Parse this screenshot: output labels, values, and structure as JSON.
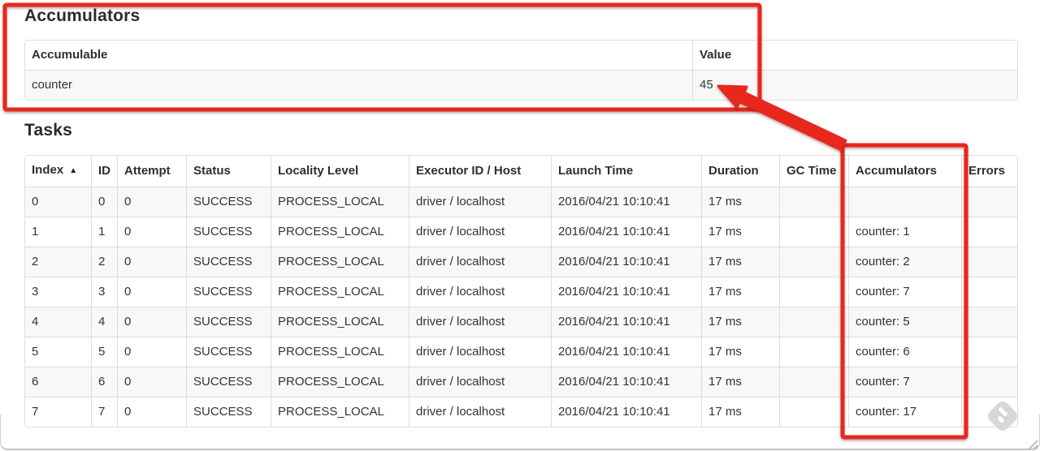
{
  "accumulators_section": {
    "title": "Accumulators",
    "table": {
      "headers": [
        "Accumulable",
        "Value"
      ],
      "rows": [
        [
          "counter",
          "45"
        ]
      ]
    }
  },
  "tasks_section": {
    "title": "Tasks",
    "table": {
      "headers": [
        "Index",
        "ID",
        "Attempt",
        "Status",
        "Locality Level",
        "Executor ID / Host",
        "Launch Time",
        "Duration",
        "GC Time",
        "Accumulators",
        "Errors"
      ],
      "sort_column": 0,
      "sort_icon": "▲",
      "rows": [
        [
          "0",
          "0",
          "0",
          "SUCCESS",
          "PROCESS_LOCAL",
          "driver / localhost",
          "2016/04/21 10:10:41",
          "17 ms",
          "",
          "",
          ""
        ],
        [
          "1",
          "1",
          "0",
          "SUCCESS",
          "PROCESS_LOCAL",
          "driver / localhost",
          "2016/04/21 10:10:41",
          "17 ms",
          "",
          "counter: 1",
          ""
        ],
        [
          "2",
          "2",
          "0",
          "SUCCESS",
          "PROCESS_LOCAL",
          "driver / localhost",
          "2016/04/21 10:10:41",
          "17 ms",
          "",
          "counter: 2",
          ""
        ],
        [
          "3",
          "3",
          "0",
          "SUCCESS",
          "PROCESS_LOCAL",
          "driver / localhost",
          "2016/04/21 10:10:41",
          "17 ms",
          "",
          "counter: 7",
          ""
        ],
        [
          "4",
          "4",
          "0",
          "SUCCESS",
          "PROCESS_LOCAL",
          "driver / localhost",
          "2016/04/21 10:10:41",
          "17 ms",
          "",
          "counter: 5",
          ""
        ],
        [
          "5",
          "5",
          "0",
          "SUCCESS",
          "PROCESS_LOCAL",
          "driver / localhost",
          "2016/04/21 10:10:41",
          "17 ms",
          "",
          "counter: 6",
          ""
        ],
        [
          "6",
          "6",
          "0",
          "SUCCESS",
          "PROCESS_LOCAL",
          "driver / localhost",
          "2016/04/21 10:10:41",
          "17 ms",
          "",
          "counter: 7",
          ""
        ],
        [
          "7",
          "7",
          "0",
          "SUCCESS",
          "PROCESS_LOCAL",
          "driver / localhost",
          "2016/04/21 10:10:41",
          "17 ms",
          "",
          "counter: 17",
          ""
        ]
      ]
    }
  },
  "annotations": {
    "color": "#e8271d",
    "highlighted_value": "45",
    "highlighted_column": "Accumulators"
  },
  "watermark": {
    "icon": "skitch-pencil"
  }
}
